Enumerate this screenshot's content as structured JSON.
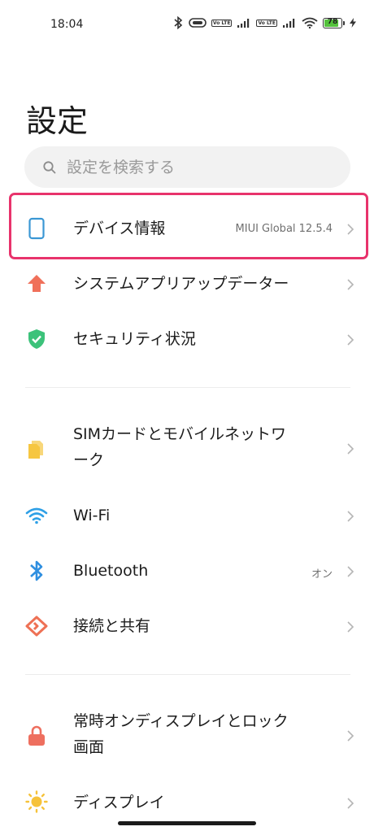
{
  "status_bar": {
    "time": "18:04",
    "volte_1": "Vo LTE",
    "volte_2": "Vo LTE",
    "battery": "78"
  },
  "page": {
    "title": "設定",
    "search_placeholder": "設定を検索する"
  },
  "items": {
    "device_info": {
      "label": "デバイス情報",
      "value": "MIUI Global 12.5.4",
      "icon": "phone-outline-icon"
    },
    "system_update": {
      "label": "システムアプリアップデーター",
      "icon": "up-arrow-icon"
    },
    "security": {
      "label": "セキュリティ状況",
      "icon": "shield-check-icon"
    },
    "sim": {
      "label_line1": "SIMカードとモバイルネットワ",
      "label_line2": "ーク",
      "icon": "sim-card-icon"
    },
    "wifi": {
      "label": "Wi-Fi",
      "icon": "wifi-icon"
    },
    "bluetooth": {
      "label": "Bluetooth",
      "value": "オン",
      "icon": "bluetooth-icon"
    },
    "connection_sharing": {
      "label": "接続と共有",
      "icon": "share-icon"
    },
    "always_on_display": {
      "label_line1": "常時オンディスプレイとロック",
      "label_line2": "画面",
      "icon": "lock-icon"
    },
    "display": {
      "label": "ディスプレイ",
      "icon": "sun-icon"
    }
  },
  "colors": {
    "highlight": "#e8336c",
    "device_icon": "#3a97d4",
    "update_icon": "#f0705a",
    "shield_icon": "#3cc27a",
    "sim_icon": "#f6c641",
    "wifi_icon": "#2fa0e6",
    "bluetooth_icon": "#2f8fe0",
    "share_icon": "#ee7155",
    "lock_icon": "#ee6f5f",
    "sun_icon": "#f6c23a"
  }
}
